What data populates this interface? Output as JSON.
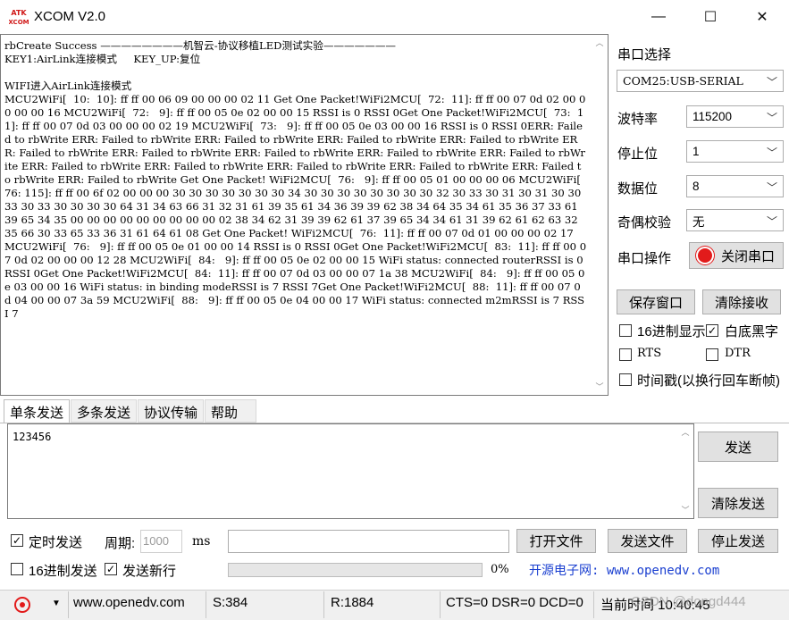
{
  "window": {
    "title": "XCOM V2.0",
    "logo_text_top": "ATK",
    "logo_text_bottom": "XCOM",
    "minimize": "—",
    "maximize": "☐",
    "close": "✕"
  },
  "receive": {
    "text": "rbCreate Success ————————机智云-协议移植LED测试实验———————\nKEY1:AirLink连接模式     KEY_UP:复位\n\nWIFI进入AirLink连接模式\nMCU2WiFi[  10:  10]: ff ff 00 06 09 00 00 00 02 11 Get One Packet!WiFi2MCU[  72:  11]: ff ff 00 07 0d 02 00 00 00 00 16 MCU2WiFi[  72:   9]: ff ff 00 05 0e 02 00 00 15 RSSI is 0 RSSI 0Get One Packet!WiFi2MCU[  73:  11]: ff ff 00 07 0d 03 00 00 00 02 19 MCU2WiFi[  73:   9]: ff ff 00 05 0e 03 00 00 16 RSSI is 0 RSSI 0ERR: Failed to rbWrite ERR: Failed to rbWrite ERR: Failed to rbWrite ERR: Failed to rbWrite ERR: Failed to rbWrite ERR: Failed to rbWrite ERR: Failed to rbWrite ERR: Failed to rbWrite ERR: Failed to rbWrite ERR: Failed to rbWrite ERR: Failed to rbWrite ERR: Failed to rbWrite ERR: Failed to rbWrite ERR: Failed to rbWrite ERR: Failed to rbWrite ERR: Failed to rbWrite Get One Packet! WiFi2MCU[  76:   9]: ff ff 00 05 01 00 00 00 06 MCU2WiFi[  76: 115]: ff ff 00 6f 02 00 00 00 30 30 30 30 30 30 30 34 30 30 30 30 30 30 30 30 32 30 33 30 31 30 31 30 30 33 30 33 30 30 30 30 64 31 34 63 66 31 32 31 61 39 35 61 34 36 39 39 62 38 34 64 35 34 61 35 36 37 33 61 39 65 34 35 00 00 00 00 00 00 00 00 00 02 38 34 62 31 39 39 62 61 37 39 65 34 34 61 31 39 62 61 62 63 32 35 66 30 33 65 33 36 31 61 64 61 08 Get One Packet! WiFi2MCU[  76:  11]: ff ff 00 07 0d 01 00 00 00 02 17 MCU2WiFi[  76:   9]: ff ff 00 05 0e 01 00 00 14 RSSI is 0 RSSI 0Get One Packet!WiFi2MCU[  83:  11]: ff ff 00 07 0d 02 00 00 00 12 28 MCU2WiFi[  84:   9]: ff ff 00 05 0e 02 00 00 15 WiFi status: connected routerRSSI is 0 RSSI 0Get One Packet!WiFi2MCU[  84:  11]: ff ff 00 07 0d 03 00 00 07 1a 38 MCU2WiFi[  84:   9]: ff ff 00 05 0e 03 00 00 16 WiFi status: in binding modeRSSI is 7 RSSI 7Get One Packet!WiFi2MCU[  88:  11]: ff ff 00 07 0d 04 00 00 07 3a 59 MCU2WiFi[  88:   9]: ff ff 00 05 0e 04 00 00 17 WiFi status: connected m2mRSSI is 7 RSSI 7"
  },
  "settings": {
    "port_label": "串口选择",
    "port_value": "COM25:USB-SERIAL",
    "baud_label": "波特率",
    "baud_value": "115200",
    "stop_label": "停止位",
    "stop_value": "1",
    "data_label": "数据位",
    "data_value": "8",
    "parity_label": "奇偶校验",
    "parity_value": "无",
    "op_label": "串口操作",
    "op_button": "关闭串口",
    "save_window": "保存窗口",
    "clear_receive": "清除接收",
    "hex_display": "16进制显示",
    "white_black": "白底黑字",
    "rts": "RTS",
    "dtr": "DTR",
    "timestamp": "时间戳(以换行回车断帧)"
  },
  "tabs": [
    "单条发送",
    "多条发送",
    "协议传输",
    "帮助"
  ],
  "send": {
    "text": "123456",
    "send_button": "发送",
    "clear_send_button": "清除发送",
    "timed_send": "定时发送",
    "period_label": "周期:",
    "period_value": "1000",
    "period_unit": "ms",
    "open_file": "打开文件",
    "send_file": "发送文件",
    "stop_send": "停止发送",
    "hex_send": "16进制发送",
    "send_newline": "发送新行",
    "progress": "0%",
    "progress_value": 0,
    "ad_text": "开源电子网: www.openedv.com"
  },
  "status": {
    "url": "www.openedv.com",
    "sent": "S:384",
    "received": "R:1884",
    "lines": "CTS=0 DSR=0 DCD=0",
    "time": "当前时间 10:40:45",
    "watermark": "CSDN @dongd444"
  },
  "colors": {
    "accent_red": "#e21b1b",
    "ad_blue": "#1a3fd0",
    "button_face": "#e1e1e1"
  }
}
